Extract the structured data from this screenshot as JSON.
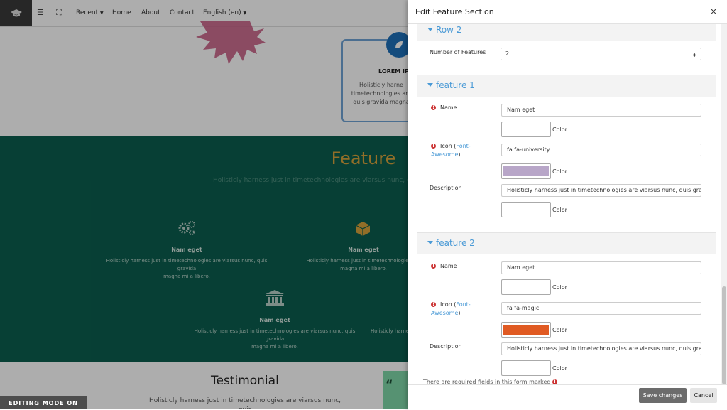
{
  "topnav": {
    "recent": "Recent",
    "home": "Home",
    "about": "About",
    "contact": "Contact",
    "language": "English (en)"
  },
  "background": {
    "lorem_card": {
      "title": "LOREM IPS",
      "text": "Holisticly harne\ntimetechnologies are\nquis gravida magna"
    },
    "feature": {
      "heading": "Feature",
      "subtitle": "Holisticly harness just in timetechnologies are viarsus nunc, q",
      "items": [
        {
          "name": "Nam eget",
          "text": "Holisticly harness just in timetechnologies are viarsus nunc, quis gravida\nmagna mi a libero.",
          "icon": "gears-icon"
        },
        {
          "name": "Nam eget",
          "text": "Holisticly harness just in timetechnologies are\nmagna mi a libero.",
          "icon": "cube-icon"
        },
        {
          "name": "Nam eget",
          "text": "Holisticly harness just in timetechnologies are viarsus nunc, quis gravida\nmagna mi a libero.",
          "icon": "university-icon"
        },
        {
          "name": "",
          "text": "Holisticly harne",
          "icon": ""
        }
      ]
    },
    "testimonial": {
      "title": "Testimonial",
      "text": "Holisticly harness just in timetechnologies are viarsus nunc, quis\ngravida magna mi a libero."
    },
    "editing_mode": "EDITING MODE ON"
  },
  "modal": {
    "title": "Edit Feature Section",
    "close": "×",
    "row2": {
      "title": "Row 2",
      "number_label": "Number of Features",
      "number_value": "2"
    },
    "features": [
      {
        "title": "feature 1",
        "name_label": "Name",
        "name_value": "Nam eget",
        "color_label": "Color",
        "name_color": "#ffffff",
        "icon_label_prefix": "Icon (",
        "icon_label_link": "Font-Awesome",
        "icon_label_suffix": ")",
        "icon_value": "fa fa-university",
        "icon_color": "#b8a6c8",
        "description_label": "Description",
        "description_value": "Holisticly harness just in timetechnologies are viarsus nunc, quis gravida",
        "description_color": "#ffffff"
      },
      {
        "title": "feature 2",
        "name_label": "Name",
        "name_value": "Nam eget",
        "color_label": "Color",
        "name_color": "#ffffff",
        "icon_label_prefix": "Icon (",
        "icon_label_link": "Font-Awesome",
        "icon_label_suffix": ")",
        "icon_value": "fa fa-magic",
        "icon_color": "#e05a22",
        "description_label": "Description",
        "description_value": "Holisticly harness just in timetechnologies are viarsus nunc, quis gravida",
        "description_color": "#ffffff"
      }
    ],
    "required_note": "There are required fields in this form marked",
    "save_label": "Save changes",
    "cancel_label": "Cancel"
  }
}
